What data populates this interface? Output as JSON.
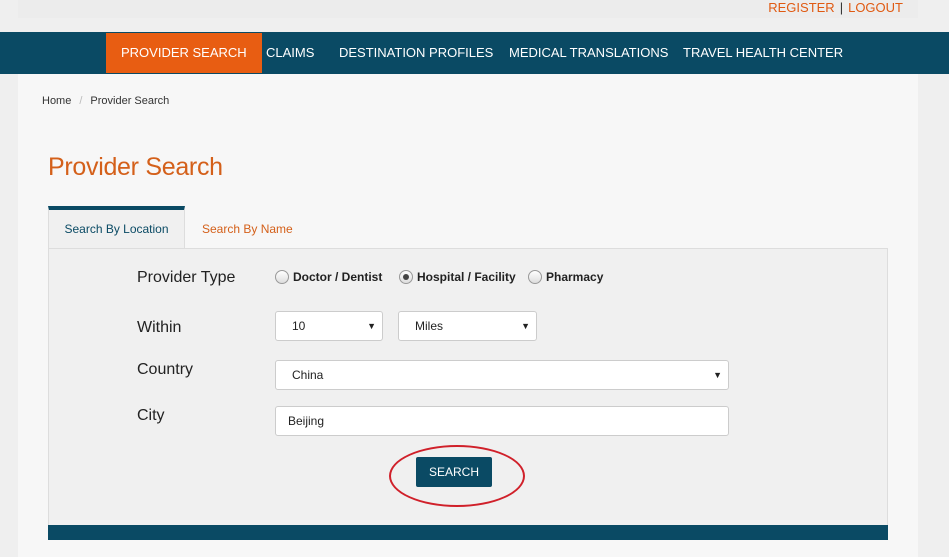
{
  "header": {
    "register_label": "REGISTER",
    "separator": "|",
    "logout_label": "LOGOUT"
  },
  "nav": {
    "items": [
      {
        "label": "PROVIDER SEARCH"
      },
      {
        "label": "CLAIMS"
      },
      {
        "label": "DESTINATION PROFILES"
      },
      {
        "label": "MEDICAL TRANSLATIONS"
      },
      {
        "label": "TRAVEL HEALTH CENTER"
      }
    ]
  },
  "breadcrumb": {
    "home": "Home",
    "separator": "/",
    "current": "Provider Search"
  },
  "page": {
    "title": "Provider Search"
  },
  "tabs": [
    {
      "label": "Search By Location"
    },
    {
      "label": "Search By Name"
    }
  ],
  "form": {
    "provider_type_label": "Provider Type",
    "provider_types": [
      {
        "label": "Doctor / Dentist",
        "checked": false
      },
      {
        "label": "Hospital / Facility",
        "checked": true
      },
      {
        "label": "Pharmacy",
        "checked": false
      }
    ],
    "within_label": "Within",
    "distance_value": "10",
    "unit_value": "Miles",
    "country_label": "Country",
    "country_value": "China",
    "city_label": "City",
    "city_value": "Beijing",
    "search_label": "SEARCH",
    "dropdown_arrow": "▼"
  },
  "colors": {
    "brand_navy": "#0a4a64",
    "accent_orange": "#e85d12",
    "annotation_red": "#d0202a"
  }
}
